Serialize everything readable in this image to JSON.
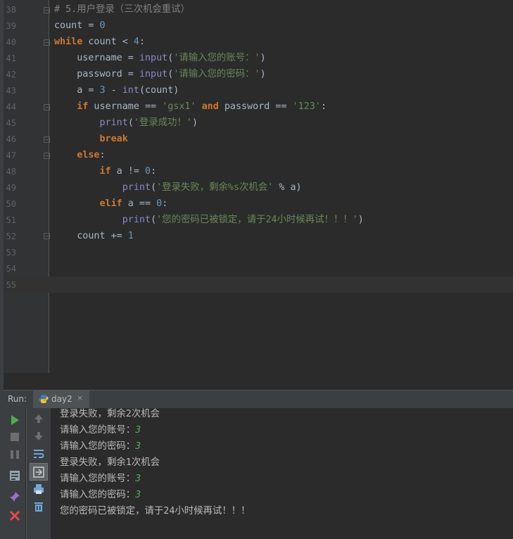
{
  "editor": {
    "line_numbers": [
      "38",
      "39",
      "40",
      "41",
      "42",
      "43",
      "44",
      "45",
      "46",
      "47",
      "48",
      "49",
      "50",
      "51",
      "52",
      "53",
      "54",
      "55"
    ],
    "lines": [
      [
        {
          "t": "# 5.用户登录（三次机会重试）",
          "c": "cmt"
        }
      ],
      [
        {
          "t": "count = ",
          "c": ""
        },
        {
          "t": "0",
          "c": "num"
        }
      ],
      [
        {
          "t": "while",
          "c": "kw"
        },
        {
          "t": " count < ",
          "c": ""
        },
        {
          "t": "4",
          "c": "num"
        },
        {
          "t": ":",
          "c": ""
        }
      ],
      [
        {
          "t": "    username = ",
          "c": ""
        },
        {
          "t": "input",
          "c": "bi"
        },
        {
          "t": "(",
          "c": ""
        },
        {
          "t": "'请输入您的账号：'",
          "c": "str"
        },
        {
          "t": ")",
          "c": ""
        }
      ],
      [
        {
          "t": "    password = ",
          "c": ""
        },
        {
          "t": "input",
          "c": "bi"
        },
        {
          "t": "(",
          "c": ""
        },
        {
          "t": "'请输入您的密码：'",
          "c": "str"
        },
        {
          "t": ")",
          "c": ""
        }
      ],
      [
        {
          "t": "    a = ",
          "c": ""
        },
        {
          "t": "3",
          "c": "num"
        },
        {
          "t": " - ",
          "c": ""
        },
        {
          "t": "int",
          "c": "bi"
        },
        {
          "t": "(count)",
          "c": ""
        }
      ],
      [
        {
          "t": "    ",
          "c": ""
        },
        {
          "t": "if",
          "c": "kw"
        },
        {
          "t": " username == ",
          "c": ""
        },
        {
          "t": "'gsx1'",
          "c": "str"
        },
        {
          "t": " ",
          "c": ""
        },
        {
          "t": "and",
          "c": "kw"
        },
        {
          "t": " password == ",
          "c": ""
        },
        {
          "t": "'123'",
          "c": "str"
        },
        {
          "t": ":",
          "c": ""
        }
      ],
      [
        {
          "t": "        ",
          "c": ""
        },
        {
          "t": "print",
          "c": "bi"
        },
        {
          "t": "(",
          "c": ""
        },
        {
          "t": "'登录成功！'",
          "c": "str"
        },
        {
          "t": ")",
          "c": ""
        }
      ],
      [
        {
          "t": "        ",
          "c": ""
        },
        {
          "t": "break",
          "c": "kw"
        }
      ],
      [
        {
          "t": "    ",
          "c": ""
        },
        {
          "t": "else",
          "c": "kw"
        },
        {
          "t": ":",
          "c": ""
        }
      ],
      [
        {
          "t": "        ",
          "c": ""
        },
        {
          "t": "if",
          "c": "kw"
        },
        {
          "t": " a != ",
          "c": ""
        },
        {
          "t": "0",
          "c": "num"
        },
        {
          "t": ":",
          "c": ""
        }
      ],
      [
        {
          "t": "            ",
          "c": ""
        },
        {
          "t": "print",
          "c": "bi"
        },
        {
          "t": "(",
          "c": ""
        },
        {
          "t": "'登录失败，剩余%s次机会'",
          "c": "str"
        },
        {
          "t": " % a)",
          "c": ""
        }
      ],
      [
        {
          "t": "        ",
          "c": ""
        },
        {
          "t": "elif",
          "c": "kw"
        },
        {
          "t": " a == ",
          "c": ""
        },
        {
          "t": "0",
          "c": "num"
        },
        {
          "t": ":",
          "c": ""
        }
      ],
      [
        {
          "t": "            ",
          "c": ""
        },
        {
          "t": "print",
          "c": "bi"
        },
        {
          "t": "(",
          "c": ""
        },
        {
          "t": "'您的密码已被锁定，请于24小时候再试！！！'",
          "c": "str"
        },
        {
          "t": ")",
          "c": ""
        }
      ],
      [
        {
          "t": "    count += ",
          "c": ""
        },
        {
          "t": "1",
          "c": "num"
        }
      ],
      [],
      [],
      []
    ]
  },
  "run_panel": {
    "title": "Run:",
    "tab_label": "day2",
    "tab_close": "×",
    "console_lines": [
      {
        "text": "登录失败，剩余2次机会",
        "input": ""
      },
      {
        "text": "请输入您的账号：",
        "input": "3"
      },
      {
        "text": "请输入您的密码：",
        "input": "3"
      },
      {
        "text": "登录失败，剩余1次机会",
        "input": ""
      },
      {
        "text": "请输入您的账号：",
        "input": "3"
      },
      {
        "text": "请输入您的密码：",
        "input": "3"
      },
      {
        "text": "您的密码已被锁定，请于24小时候再试！！！",
        "input": ""
      }
    ]
  },
  "colors": {
    "keyword": "#cc7832",
    "number": "#6897bb",
    "string": "#6a8759",
    "builtin": "#8888c6",
    "comment": "#808080",
    "console_input": "#62a362"
  },
  "icons": {
    "toolbar_left": [
      "run-icon",
      "stop-icon",
      "pause-icon",
      "dump-threads-icon",
      "pin-icon",
      "close-icon"
    ],
    "toolbar_right": [
      "up-arrow-icon",
      "down-arrow-icon",
      "soft-wrap-icon",
      "scroll-to-end-icon",
      "print-icon",
      "trash-icon"
    ]
  }
}
